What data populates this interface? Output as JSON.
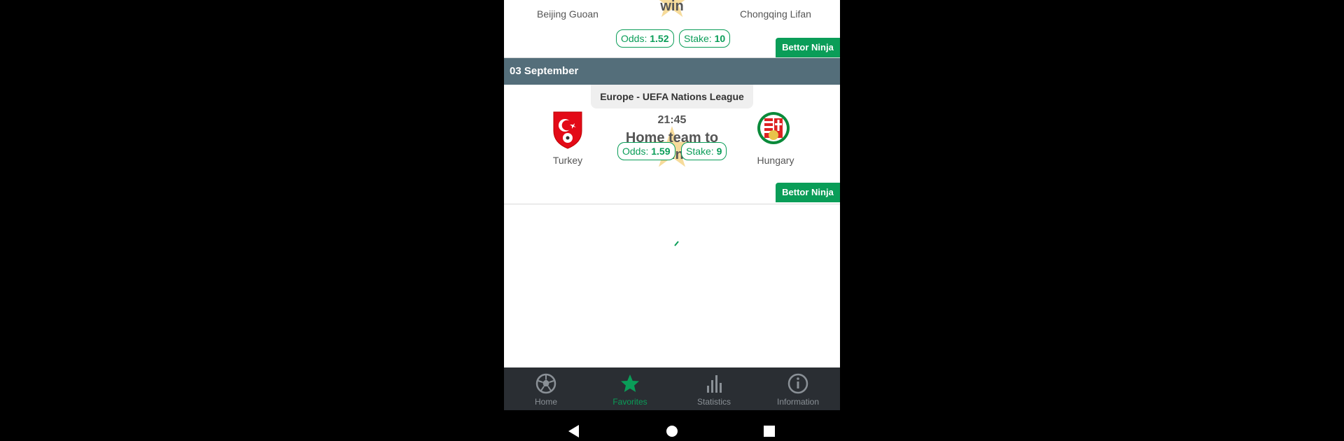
{
  "match1": {
    "home_team": "Beijing Guoan",
    "away_team": "Chongqing Lifan",
    "pick_partial": "win",
    "odds_label": "Odds:",
    "odds_value": "1.52",
    "stake_label": "Stake:",
    "stake_value": "10",
    "tipster": "Bettor Ninja"
  },
  "date_header": "03 September",
  "match2": {
    "league": "Europe - UEFA Nations League",
    "time": "21:45",
    "home_team": "Turkey",
    "away_team": "Hungary",
    "pick_line1": "Home team to",
    "pick_line2": "win",
    "odds_label": "Odds:",
    "odds_value": "1.59",
    "stake_label": "Stake:",
    "stake_value": "9",
    "tipster": "Bettor Ninja"
  },
  "nav": {
    "items": [
      {
        "label": "Home",
        "icon": "soccer-ball-icon"
      },
      {
        "label": "Favorites",
        "icon": "star-icon",
        "active": true
      },
      {
        "label": "Statistics",
        "icon": "bar-chart-icon"
      },
      {
        "label": "Information",
        "icon": "info-icon"
      }
    ]
  },
  "colors": {
    "accent": "#0a9d58",
    "date_bar": "#546e7a",
    "nav_bg": "#2a2e33"
  }
}
